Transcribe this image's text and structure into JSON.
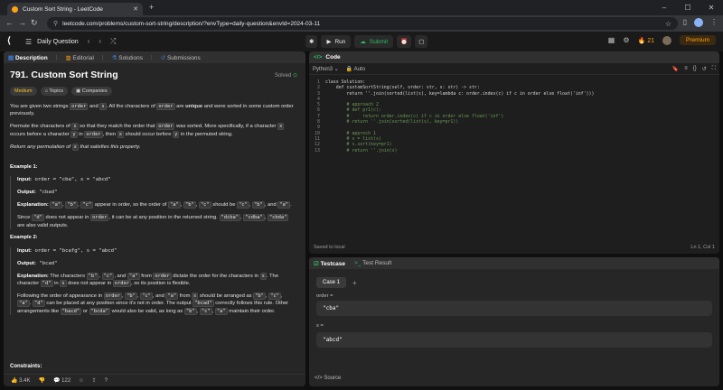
{
  "browser": {
    "tab_title": "Custom Sort String - LeetCode",
    "url": "leetcode.com/problems/custom-sort-string/description/?envType=daily-question&envId=2024-03-11"
  },
  "header": {
    "daily_label": "Daily Question",
    "run_label": "Run",
    "submit_label": "Submit",
    "streak_count": "21",
    "premium_label": "Premium"
  },
  "left_tabs": {
    "description": "Description",
    "editorial": "Editorial",
    "solutions": "Solutions",
    "submissions": "Submissions"
  },
  "problem": {
    "title": "791. Custom Sort String",
    "solved": "Solved",
    "difficulty": "Medium",
    "topics": "Topics",
    "companies": "Companies",
    "p1_a": "You are given two strings ",
    "p1_order": "order",
    "p1_b": " and ",
    "p1_s": "s",
    "p1_c": ". All the characters of ",
    "p1_order2": "order",
    "p1_d": " are ",
    "p1_unique": "unique",
    "p1_e": " and were sorted in some custom order previously.",
    "p2_a": "Permute the characters of ",
    "p2_s": "s",
    "p2_b": " so that they match the order that ",
    "p2_order": "order",
    "p2_c": " was sorted. More specifically, if a character ",
    "p2_x": "x",
    "p2_d": " occurs before a character ",
    "p2_y": "y",
    "p2_e": " in ",
    "p2_order2": "order",
    "p2_f": ", then ",
    "p2_x2": "x",
    "p2_g": " should occur before ",
    "p2_y2": "y",
    "p2_h": " in the permuted string.",
    "p3_a": "Return any permutation of ",
    "p3_s": "s",
    "p3_b": " that satisfies this property.",
    "ex1_title": "Example 1:",
    "ex1_input_label": "Input:",
    "ex1_input": " order = \"cba\", s = \"abcd\"",
    "ex1_output_label": "Output:",
    "ex1_output": " \"cbad\"",
    "ex1_expl_label": "Explanation:",
    "ex1_e1": "\"a\"",
    "ex1_e2": "\"b\"",
    "ex1_e3": "\"c\"",
    "ex1_e_mid": " appear in order, so the order of ",
    "ex1_e4": "\"a\"",
    "ex1_e5": "\"b\"",
    "ex1_e6": "\"c\"",
    "ex1_e_mid2": " should be ",
    "ex1_e7": "\"c\"",
    "ex1_e8": "\"b\"",
    "ex1_e_and": ", and ",
    "ex1_e9": "\"a\"",
    "ex1_since_a": "Since ",
    "ex1_since_d": "\"d\"",
    "ex1_since_b": " does not appear in ",
    "ex1_since_order": "order",
    "ex1_since_c": ", it can be at any position in the returned string. ",
    "ex1_dcba": "\"dcba\"",
    "ex1_cdba": "\"cdba\"",
    "ex1_cbda": "\"cbda\"",
    "ex1_since_e": " are also valid outputs.",
    "ex2_title": "Example 2:",
    "ex2_input_label": "Input:",
    "ex2_input": " order = \"bcafg\", s = \"abcd\"",
    "ex2_output_label": "Output:",
    "ex2_output": " \"bcad\"",
    "ex2_expl_label": "Explanation:",
    "ex2_a": " The characters ",
    "ex2_b1": "\"b\"",
    "ex2_c1": "\"c\"",
    "ex2_and": ", and ",
    "ex2_a1": "\"a\"",
    "ex2_from": " from ",
    "ex2_order": "order",
    "ex2_dict": " dictate the order for the characters in ",
    "ex2_s": "s",
    "ex2_char": ". The character ",
    "ex2_d": "\"d\"",
    "ex2_in": " in ",
    "ex2_s2": "s",
    "ex2_dna": " does not appear in ",
    "ex2_order2": "order",
    "ex2_flex": ", so its position is flexible.",
    "ex2_f_a": "Following the order of appearance in ",
    "ex2_f_order": "order",
    "ex2_f_b": "\"b\"",
    "ex2_f_c": "\"c\"",
    "ex2_f_and": ", and ",
    "ex2_f_a1": "\"a\"",
    "ex2_f_from": " from ",
    "ex2_f_s": "s",
    "ex2_f_arr": " should be arranged as ",
    "ex2_f_b2": "\"b\"",
    "ex2_f_c2": "\"c\"",
    "ex2_f_a2": "\"a\"",
    "ex2_f_d": "\"d\"",
    "ex2_f_cont": " can be placed at any position since it's not in order. The output ",
    "ex2_f_bcad": "\"bcad\"",
    "ex2_f_cont2": " correctly follows this rule. Other arrangements like ",
    "ex2_f_bacd": "\"bacd\"",
    "ex2_f_or": " or ",
    "ex2_f_bcda": "\"bcda\"",
    "ex2_f_cont3": " would also be valid, as long as ",
    "ex2_f_b3": "\"b\"",
    "ex2_f_c3": "\"c\"",
    "ex2_f_a3": "\"a\"",
    "ex2_f_end": " maintain their order.",
    "constraints": "Constraints:"
  },
  "left_footer": {
    "likes": "3.4K",
    "comments": "122"
  },
  "editor": {
    "tab": "Code",
    "language": "Python3",
    "mode": "Auto",
    "saved": "Saved to local",
    "cursor": "Ln 1, Col 1",
    "lines": [
      {
        "n": "1",
        "t": "class Solution:",
        "c": false
      },
      {
        "n": "2",
        "t": "    def customSortString(self, order: str, s: str) -> str:",
        "c": false
      },
      {
        "n": "3",
        "t": "        return ''.join(sorted(list(s), key=lambda c: order.index(c) if c in order else float('inf')))",
        "c": false
      },
      {
        "n": "4",
        "t": "",
        "c": false
      },
      {
        "n": "5",
        "t": "        # approach 2",
        "c": true
      },
      {
        "n": "6",
        "t": "        # def pr1(c):",
        "c": true
      },
      {
        "n": "7",
        "t": "        #     return order.index(c) if c in order else float('inf')",
        "c": true
      },
      {
        "n": "8",
        "t": "        # return ''.join(sorted(list(s), key=pr1))",
        "c": true
      },
      {
        "n": "9",
        "t": "",
        "c": false
      },
      {
        "n": "10",
        "t": "        # approch 1",
        "c": true
      },
      {
        "n": "11",
        "t": "        # s = list(s)",
        "c": true
      },
      {
        "n": "12",
        "t": "        # s.sort(key=pr1)",
        "c": true
      },
      {
        "n": "13",
        "t": "        # return ''.join(s)",
        "c": true
      }
    ]
  },
  "testcase": {
    "tab": "Testcase",
    "result_tab": "Test Result",
    "case_label": "Case 1",
    "order_label": "order =",
    "order_value": "\"cba\"",
    "s_label": "s =",
    "s_value": "\"abcd\"",
    "source": "Source"
  }
}
